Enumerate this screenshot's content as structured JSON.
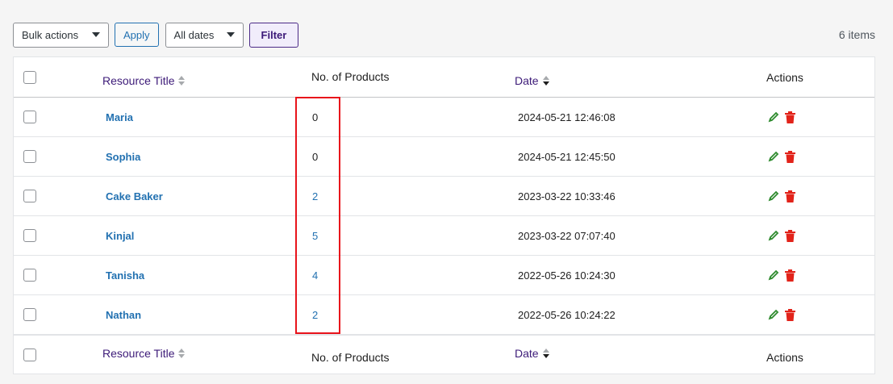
{
  "toolbar": {
    "bulk_actions": "Bulk actions",
    "apply": "Apply",
    "all_dates": "All dates",
    "filter": "Filter",
    "items_count": "6 items"
  },
  "table": {
    "headers": {
      "title": "Resource Title",
      "products": "No. of Products",
      "date": "Date",
      "actions": "Actions"
    },
    "rows": [
      {
        "title": "Maria",
        "products": "0",
        "date": "2024-05-21 12:46:08"
      },
      {
        "title": "Sophia",
        "products": "0",
        "date": "2024-05-21 12:45:50"
      },
      {
        "title": "Cake Baker",
        "products": "2",
        "date": "2023-03-22 10:33:46"
      },
      {
        "title": "Kinjal",
        "products": "5",
        "date": "2023-03-22 07:07:40"
      },
      {
        "title": "Tanisha",
        "products": "4",
        "date": "2022-05-26 10:24:30"
      },
      {
        "title": "Nathan",
        "products": "2",
        "date": "2022-05-26 10:24:22"
      }
    ]
  },
  "colors": {
    "accent": "#3c1a78",
    "link": "#2271b1",
    "edit_icon": "#2e8b2e",
    "delete_icon": "#e2231a",
    "highlight": "#e8131b"
  },
  "icons": {
    "edit": "pencil-icon",
    "delete": "trash-icon"
  }
}
